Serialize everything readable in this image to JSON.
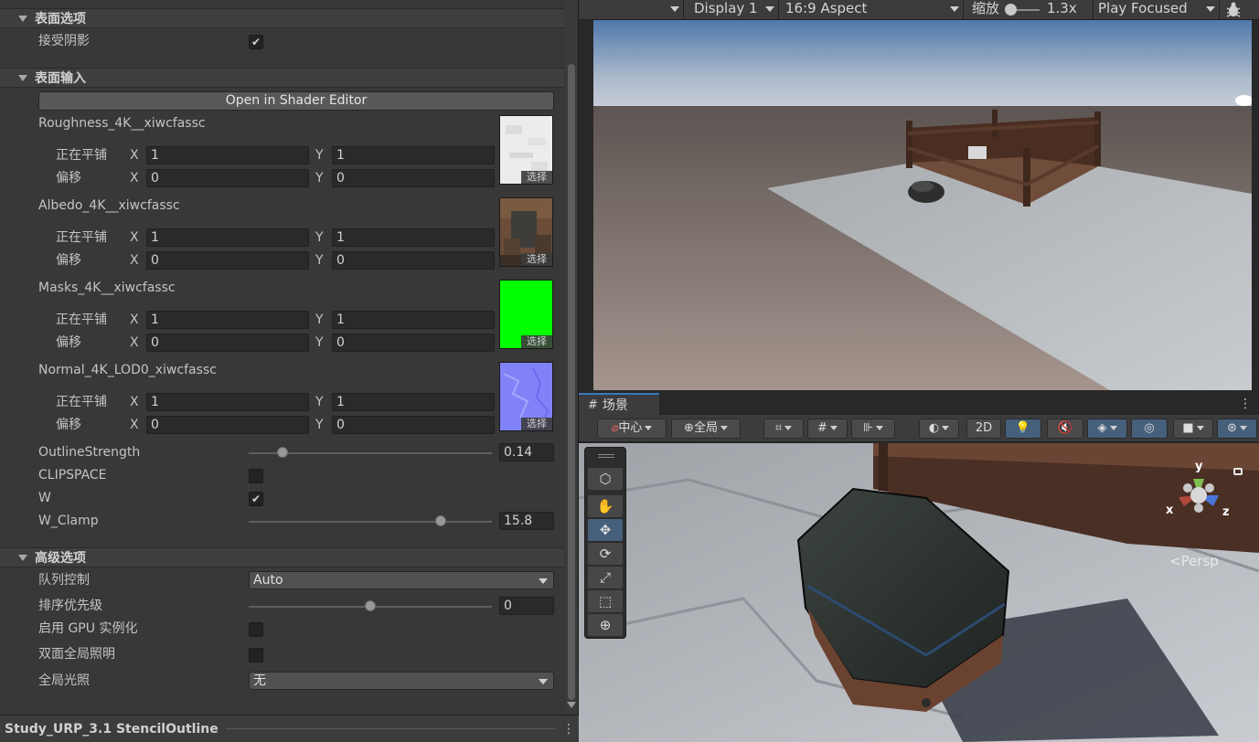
{
  "inspector": {
    "surface_options": {
      "title": "表面选项",
      "receive_shadows_label": "接受阴影",
      "receive_shadows_checked": true
    },
    "surface_inputs": {
      "title": "表面输入",
      "open_shader_editor": "Open in Shader Editor"
    },
    "textures": [
      {
        "name": "Roughness_4K__xiwcfassc",
        "tiling_label": "正在平铺",
        "offset_label": "偏移",
        "tiling_x": "1",
        "tiling_y": "1",
        "offset_x": "0",
        "offset_y": "0",
        "select_label": "选择",
        "swatch_color": "#eaeaea"
      },
      {
        "name": "Albedo_4K__xiwcfassc",
        "tiling_label": "正在平铺",
        "offset_label": "偏移",
        "tiling_x": "1",
        "tiling_y": "1",
        "offset_x": "0",
        "offset_y": "0",
        "select_label": "选择",
        "swatch_color": "#5a4636"
      },
      {
        "name": "Masks_4K__xiwcfassc",
        "tiling_label": "正在平铺",
        "offset_label": "偏移",
        "tiling_x": "1",
        "tiling_y": "1",
        "offset_x": "0",
        "offset_y": "0",
        "select_label": "选择",
        "swatch_color": "#00ff00"
      },
      {
        "name": "Normal_4K_LOD0_xiwcfassc",
        "tiling_label": "正在平铺",
        "offset_label": "偏移",
        "tiling_x": "1",
        "tiling_y": "1",
        "offset_x": "0",
        "offset_y": "0",
        "select_label": "选择",
        "swatch_color": "#8080ff"
      }
    ],
    "axis_x": "X",
    "axis_y": "Y",
    "outline_strength": {
      "label": "OutlineStrength",
      "value": "0.14",
      "slider_fraction": 0.14
    },
    "clipspace": {
      "label": "CLIPSPACE",
      "checked": false
    },
    "w": {
      "label": "W",
      "checked": true
    },
    "w_clamp": {
      "label": "W_Clamp",
      "value": "15.8",
      "slider_fraction": 0.79
    },
    "advanced": {
      "title": "高级选项",
      "queue_control_label": "队列控制",
      "queue_control_value": "Auto",
      "sort_priority_label": "排序优先级",
      "sort_priority_value": "0",
      "sort_priority_fraction": 0.5,
      "gpu_instancing_label": "启用 GPU 实例化",
      "double_sided_gi_label": "双面全局照明",
      "global_illumination_label": "全局光照",
      "global_illumination_value": "无"
    },
    "footer_title": "Study_URP_3.1 StencilOutline",
    "footer_menu": "⋮",
    "check_glyph": "✔"
  },
  "game_view": {
    "display": "Display 1",
    "aspect": "16:9 Aspect",
    "scale_label": "缩放",
    "scale_value": "1.3x",
    "play_mode": "Play Focused",
    "bug_icon": "bug-icon"
  },
  "scene_view": {
    "tab_label": "场景",
    "tab_icon": "#",
    "menu_glyph": "⋮",
    "pivot_label": "中心",
    "global_label": "全局",
    "mode_2d": "2D",
    "persp_label": "<Persp",
    "gizmo_y": "y",
    "gizmo_x": "x",
    "gizmo_z": "z"
  },
  "colors": {
    "accent_blue": "#46607c",
    "tab_highlight": "#3a79bb",
    "masks_green": "#00ff00",
    "normal_blue": "#8080ff"
  }
}
